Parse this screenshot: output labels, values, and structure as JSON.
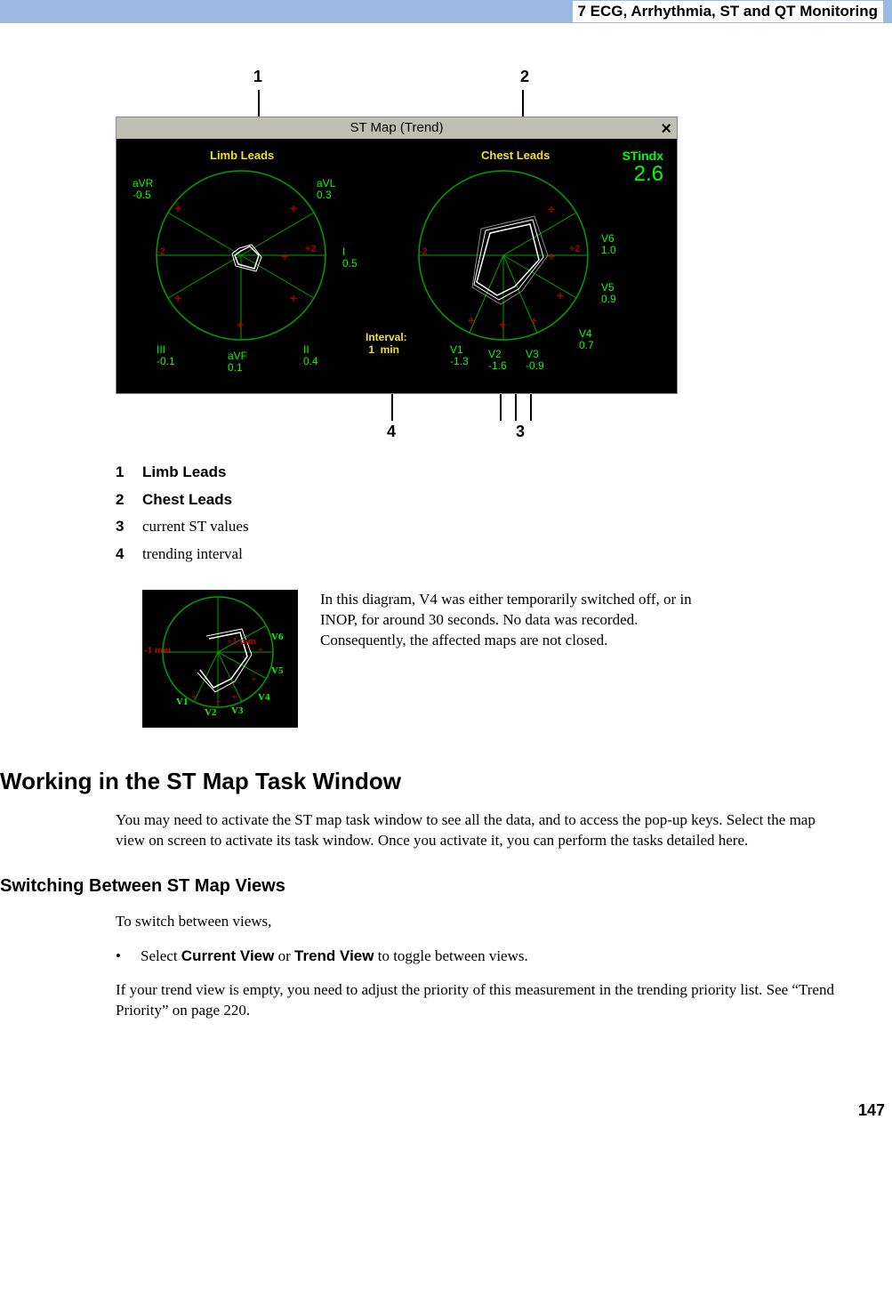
{
  "header": {
    "chapter": "7  ECG, Arrhythmia, ST and QT Monitoring"
  },
  "stmap": {
    "title": "ST Map (Trend)",
    "close": "×",
    "callouts": {
      "c1": "1",
      "c2": "2",
      "c3": "3",
      "c4": "4"
    },
    "limb_label": "Limb Leads",
    "chest_label": "Chest Leads",
    "stindex_label": "STindx",
    "stindex_value": "2.6",
    "axis_neg": "-2",
    "axis_pos": "+2",
    "interval": "Interval:\n 1  min",
    "limb_leads": {
      "aVR": "aVR\n-0.5",
      "aVL": "aVL\n0.3",
      "I": "I\n0.5",
      "II": "II\n0.4",
      "aVF": "aVF\n0.1",
      "III": "III\n-0.1"
    },
    "chest_leads": {
      "V1": "V1\n-1.3",
      "V2": "V2\n-1.6",
      "V3": "V3\n-0.9",
      "V4": "V4\n0.7",
      "V5": "V5\n0.9",
      "V6": "V6\n1.0"
    }
  },
  "legend": {
    "n1": "1",
    "n2": "2",
    "n3": "3",
    "n4": "4",
    "t1": "Limb Leads",
    "t2": "Chest Leads",
    "t3": "current ST values",
    "t4": "trending interval"
  },
  "small_fig": {
    "mm_pos": "+1 mm",
    "mm_neg": "-1 mm",
    "V1": "V1",
    "V2": "V2",
    "V3": "V3",
    "V4": "V4",
    "V5": "V5",
    "V6": "V6"
  },
  "note_para": "In this diagram, V4 was either temporarily switched off, or in INOP, for around 30 seconds. No data was recorded. Consequently, the affected maps are not closed.",
  "h2": "Working in the ST Map Task Window",
  "p_intro": "You may need to activate the ST map task window to see all the data, and to access the pop-up keys. Select the map view on screen to activate its task window. Once you activate it, you can perform the tasks detailed here.",
  "h3": "Switching Between ST Map Views",
  "p_switch": "To switch between views,",
  "bullet": {
    "pre": "Select ",
    "cv": "Current View",
    "mid": " or ",
    "tv": "Trend View",
    "post": " to toggle between views."
  },
  "p_trend": "If your trend view is empty, you need to adjust the priority of this measurement in the trending priority list. See “Trend Priority” on page 220.",
  "page": "147",
  "chart_data": {
    "type": "radar",
    "title": "ST Map (Trend)",
    "stindex": 2.6,
    "axis_range_mm": [
      -2,
      2
    ],
    "trending_interval_min": 1,
    "series": [
      {
        "name": "Limb Leads",
        "labels": [
          "aVR",
          "aVL",
          "I",
          "II",
          "aVF",
          "III"
        ],
        "values": [
          -0.5,
          0.3,
          0.5,
          0.4,
          0.1,
          -0.1
        ]
      },
      {
        "name": "Chest Leads",
        "labels": [
          "V1",
          "V2",
          "V3",
          "V4",
          "V5",
          "V6"
        ],
        "values": [
          -1.3,
          -1.6,
          -0.9,
          0.7,
          0.9,
          1.0
        ]
      }
    ]
  }
}
